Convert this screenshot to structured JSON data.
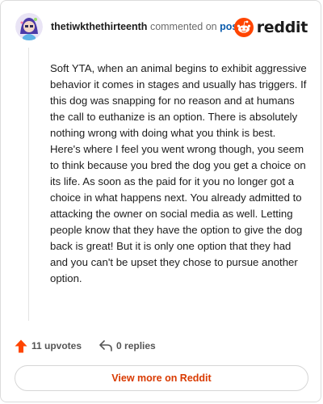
{
  "header": {
    "username": "thetiwkthethirteenth",
    "commented_on": "commented on",
    "post_link": "post",
    "brand": "reddit"
  },
  "comment": {
    "body": "Soft YTA, when an animal begins to exhibit aggressive behavior it comes in stages and usually has triggers. If this dog was snapping for no reason and at humans the call to euthanize is an option. There is absolutely nothing wrong with doing what you think is best. Here's where I feel you went wrong though, you seem to think because you bred the dog you get a choice on its life. As soon as the paid for it you no longer got a choice in what happens next. You already admitted to attacking the owner on social media as well. Letting people know that they have the option to give the dog back is great! But it is only one option that they had and you can't be upset they chose to pursue another option."
  },
  "actions": {
    "upvotes": "11 upvotes",
    "replies": "0 replies"
  },
  "footer": {
    "view_more": "View more on Reddit"
  },
  "colors": {
    "brand_orange": "#ff4500",
    "link_blue": "#0b5cad",
    "view_more_text": "#d93a00"
  },
  "icons": {
    "upvote": "upvote-arrow-icon",
    "reply": "reply-arrow-icon",
    "logo": "reddit-snoo-icon",
    "avatar": "user-avatar"
  }
}
